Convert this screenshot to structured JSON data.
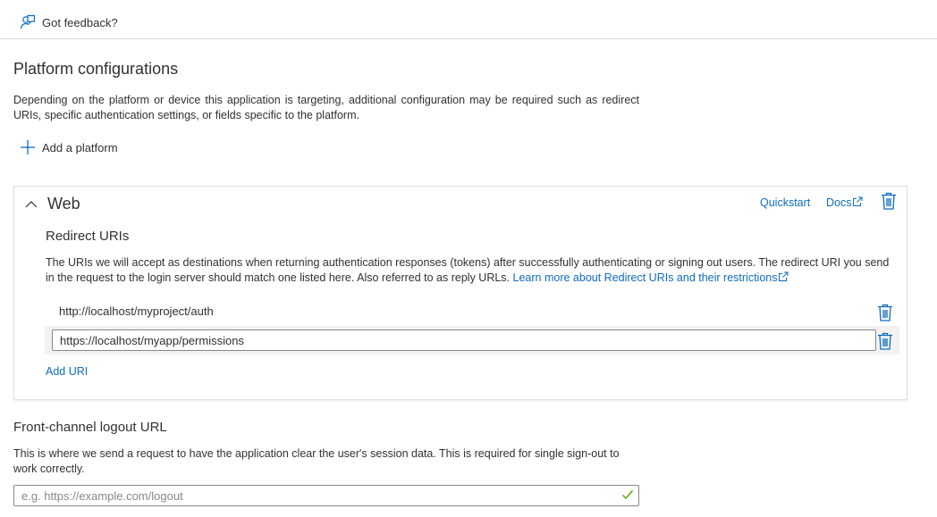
{
  "feedback": {
    "label": "Got feedback?"
  },
  "platform": {
    "title": "Platform configurations",
    "description": "Depending on the platform or device this application is targeting, additional configuration may be required such as redirect URIs, specific authentication settings, or fields specific to the platform.",
    "add_label": "Add a platform"
  },
  "web": {
    "title": "Web",
    "quickstart_label": "Quickstart",
    "docs_label": "Docs",
    "redirect": {
      "title": "Redirect URIs",
      "description": "The URIs we will accept as destinations when returning authentication responses (tokens) after successfully authenticating or signing out users. The redirect URI you send in the request to the login server should match one listed here. Also referred to as reply URLs.",
      "learn_more": "Learn more about Redirect URIs and their restrictions",
      "uris": [
        "http://localhost/myproject/auth",
        "https://localhost/myapp/permissions"
      ],
      "add_label": "Add URI"
    }
  },
  "logout": {
    "title": "Front-channel logout URL",
    "description": "This is where we send a request to have the application clear the user's session data. This is required for single sign-out to work correctly.",
    "placeholder": "e.g. https://example.com/logout"
  },
  "colors": {
    "link": "#0f6cbd",
    "check": "#57a300",
    "text": "#323130"
  },
  "icons": [
    "feedback-icon",
    "plus-icon",
    "chevron-up-icon",
    "external-link-icon",
    "trash-icon",
    "checkmark-icon"
  ]
}
